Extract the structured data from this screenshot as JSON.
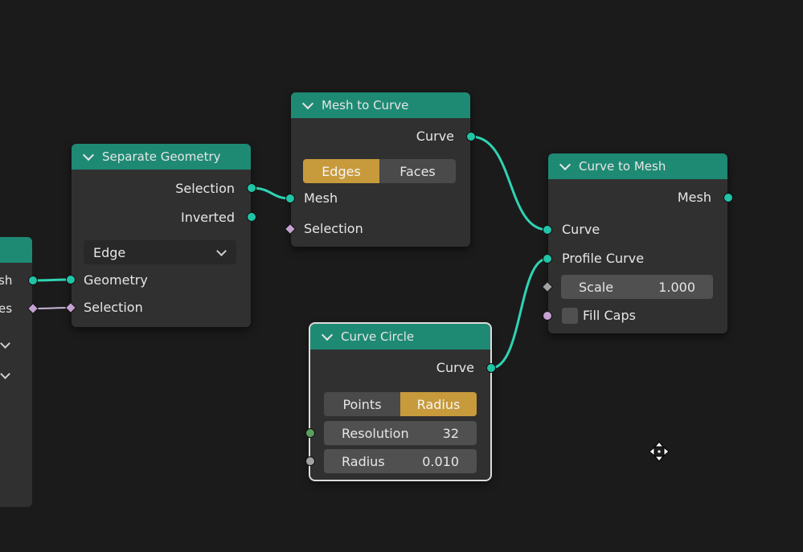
{
  "colors": {
    "background": "#1b1b1b",
    "node_body": "#303030",
    "header": "#1e8a74",
    "geometry_socket": "#21c4a6",
    "field_socket": "#c5a1d2",
    "active_toggle": "#c79a3c",
    "link": "#2fd4b3",
    "field_link": "#c9b6d6"
  },
  "left_node": {
    "output_mesh_partial": "sh",
    "output_selection_partial": "es"
  },
  "separate_geometry": {
    "title": "Separate Geometry",
    "out_selection": "Selection",
    "out_inverted": "Inverted",
    "domain_value": "Edge",
    "in_geometry": "Geometry",
    "in_selection": "Selection"
  },
  "mesh_to_curve": {
    "title": "Mesh to Curve",
    "out_curve": "Curve",
    "mode_edges": "Edges",
    "mode_faces": "Faces",
    "in_mesh": "Mesh",
    "in_selection": "Selection"
  },
  "curve_to_mesh": {
    "title": "Curve to Mesh",
    "out_mesh": "Mesh",
    "in_curve": "Curve",
    "in_profile": "Profile Curve",
    "scale_label": "Scale",
    "scale_value": "1.000",
    "fill_caps": "Fill Caps"
  },
  "curve_circle": {
    "title": "Curve Circle",
    "out_curve": "Curve",
    "mode_points": "Points",
    "mode_radius": "Radius",
    "resolution_label": "Resolution",
    "resolution_value": "32",
    "radius_label": "Radius",
    "radius_value": "0.010"
  },
  "icons": {
    "collapse": "chevron-down-icon",
    "dropdown": "chevron-down-icon",
    "cursor": "move-cursor-icon"
  }
}
